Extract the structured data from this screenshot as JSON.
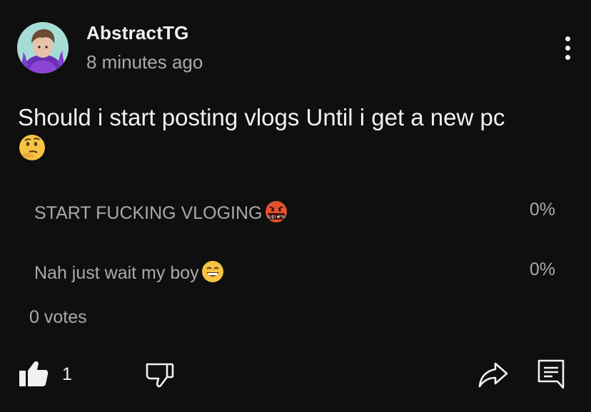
{
  "post": {
    "author": "AbstractTG",
    "timestamp": "8 minutes ago",
    "text": "Should i start posting vlogs Until i get a new pc",
    "text_emoji": "thinking-face",
    "menu_icon": "more-vert-icon"
  },
  "poll": {
    "options": [
      {
        "label": "START FUCKING VLOGING",
        "emoji": "face-with-symbols-on-mouth",
        "percent": "0%"
      },
      {
        "label": "Nah just wait my boy",
        "emoji": "grinning-face",
        "percent": "0%"
      }
    ],
    "votes": "0 votes"
  },
  "actions": {
    "like_icon": "thumbs-up-icon",
    "like_count": "1",
    "dislike_icon": "thumbs-down-icon",
    "share_icon": "share-icon",
    "comment_icon": "comment-icon"
  },
  "colors": {
    "background": "#0f0f0f",
    "primary_text": "#f1f1f1",
    "secondary_text": "#aaaaaa"
  }
}
